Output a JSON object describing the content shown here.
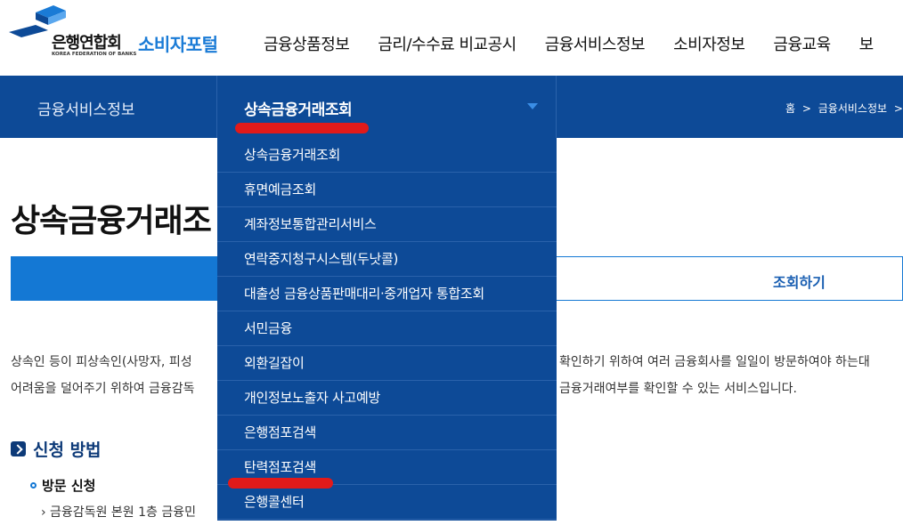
{
  "header": {
    "logo_text": "은행연합회",
    "logo_sub": "KOREA FEDERATION OF BANKS",
    "portal_name": "소비자포털",
    "gnb": [
      "금융상품정보",
      "금리/수수료 비교공시",
      "금융서비스정보",
      "소비자정보",
      "금융교육",
      "보"
    ]
  },
  "subnav": {
    "category": "금융서비스정보",
    "current": "상속금융거래조회",
    "breadcrumb": [
      "홈",
      ">",
      "금융서비스정보",
      ">",
      "상"
    ]
  },
  "dropdown": {
    "items": [
      "상속금융거래조회",
      "휴면예금조회",
      "계좌정보통합관리서비스",
      "연락중지청구시스템(두낫콜)",
      "대출성 금융상품판매대리·중개업자 통합조회",
      "서민금융",
      "외환길잡이",
      "개인정보노출자 사고예방",
      "은행점포검색",
      "탄력점포검색",
      "은행콜센터"
    ]
  },
  "main": {
    "title": "상속금융거래조",
    "tab_label": "조회하기",
    "desc_line1_left": "상속인 등이 피상속인(사망자, 피성",
    "desc_line1_right": "확인하기 위하여 여러 금융회사를 일일이 방문하여야 하는대",
    "desc_line2_left": "어려움을 덜어주기 위하여 금융감독",
    "desc_line2_right": "금융거래여부를 확인할 수 있는 서비스입니다.",
    "section_title": "신청 방법",
    "sub_title": "방문 신청",
    "sub_item": "› 금융감독원 본원 1층 금융민"
  },
  "colors": {
    "nav_bg": "#0d4a97",
    "accent": "#1478d4",
    "highlight": "#e11a1a"
  }
}
